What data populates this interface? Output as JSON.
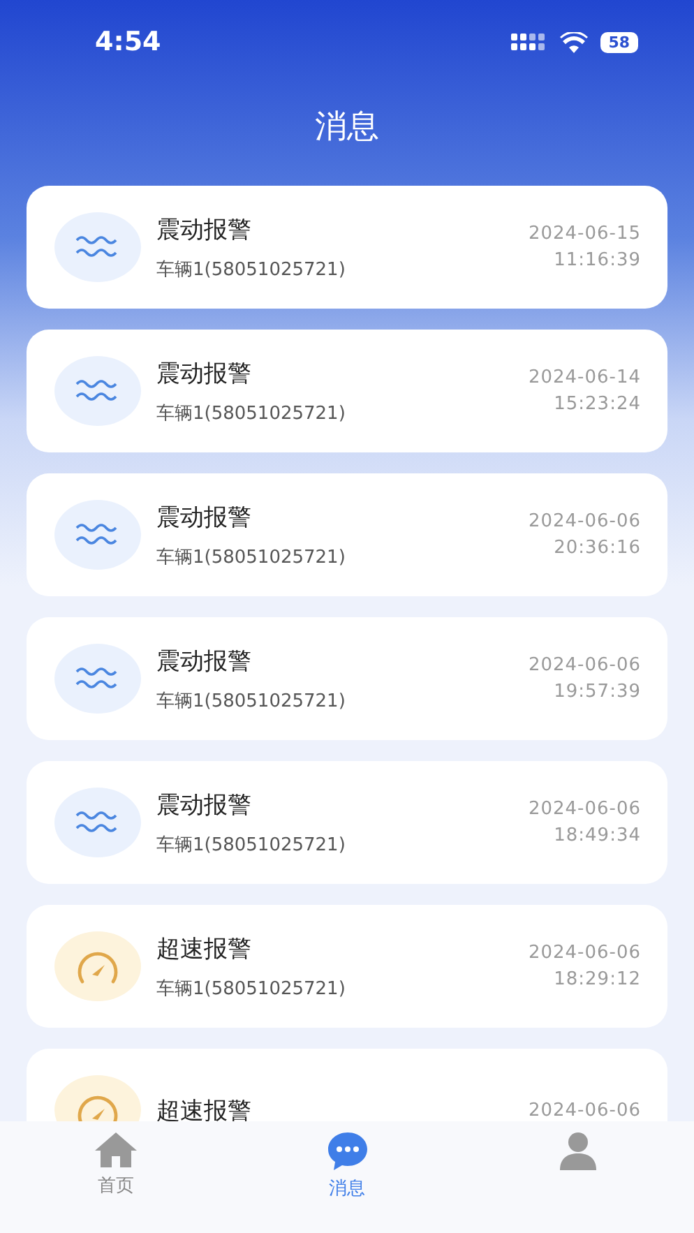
{
  "status_bar": {
    "time": "4:54",
    "battery": "58"
  },
  "header": {
    "title": "消息"
  },
  "messages": [
    {
      "kind": "vibration",
      "title": "震动报警",
      "vehicle": "车辆1(58051025721)",
      "date": "2024-06-15",
      "time": "11:16:39"
    },
    {
      "kind": "vibration",
      "title": "震动报警",
      "vehicle": "车辆1(58051025721)",
      "date": "2024-06-14",
      "time": "15:23:24"
    },
    {
      "kind": "vibration",
      "title": "震动报警",
      "vehicle": "车辆1(58051025721)",
      "date": "2024-06-06",
      "time": "20:36:16"
    },
    {
      "kind": "vibration",
      "title": "震动报警",
      "vehicle": "车辆1(58051025721)",
      "date": "2024-06-06",
      "time": "19:57:39"
    },
    {
      "kind": "vibration",
      "title": "震动报警",
      "vehicle": "车辆1(58051025721)",
      "date": "2024-06-06",
      "time": "18:49:34"
    },
    {
      "kind": "speed",
      "title": "超速报警",
      "vehicle": "车辆1(58051025721)",
      "date": "2024-06-06",
      "time": "18:29:12"
    },
    {
      "kind": "speed",
      "title": "超速报警",
      "date": "2024-06-06"
    }
  ],
  "tab_bar": [
    {
      "kind": "home",
      "label": "首页",
      "selected": false
    },
    {
      "kind": "messages",
      "label": "消息",
      "selected": true
    },
    {
      "kind": "profile",
      "selected": false
    }
  ]
}
